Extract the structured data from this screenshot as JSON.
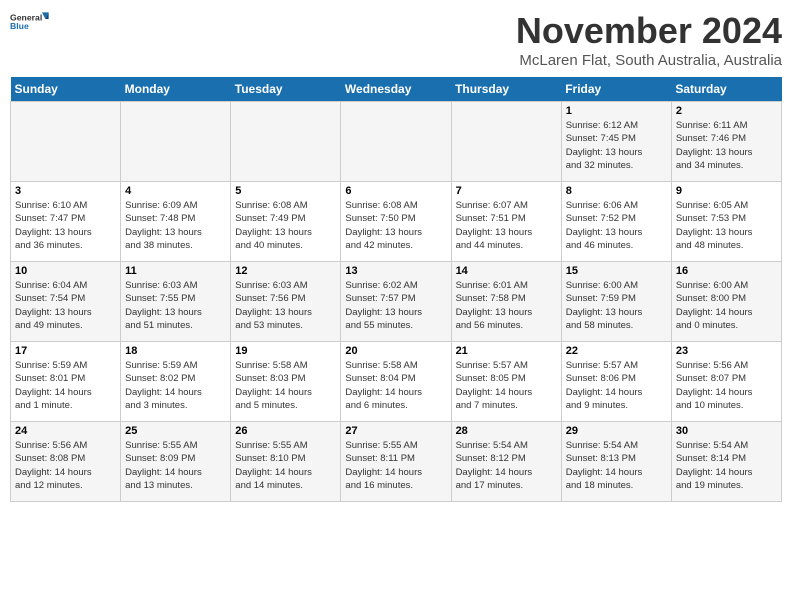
{
  "header": {
    "logo_line1": "General",
    "logo_line2": "Blue",
    "month": "November 2024",
    "location": "McLaren Flat, South Australia, Australia"
  },
  "weekdays": [
    "Sunday",
    "Monday",
    "Tuesday",
    "Wednesday",
    "Thursday",
    "Friday",
    "Saturday"
  ],
  "weeks": [
    [
      {
        "day": "",
        "info": ""
      },
      {
        "day": "",
        "info": ""
      },
      {
        "day": "",
        "info": ""
      },
      {
        "day": "",
        "info": ""
      },
      {
        "day": "",
        "info": ""
      },
      {
        "day": "1",
        "info": "Sunrise: 6:12 AM\nSunset: 7:45 PM\nDaylight: 13 hours\nand 32 minutes."
      },
      {
        "day": "2",
        "info": "Sunrise: 6:11 AM\nSunset: 7:46 PM\nDaylight: 13 hours\nand 34 minutes."
      }
    ],
    [
      {
        "day": "3",
        "info": "Sunrise: 6:10 AM\nSunset: 7:47 PM\nDaylight: 13 hours\nand 36 minutes."
      },
      {
        "day": "4",
        "info": "Sunrise: 6:09 AM\nSunset: 7:48 PM\nDaylight: 13 hours\nand 38 minutes."
      },
      {
        "day": "5",
        "info": "Sunrise: 6:08 AM\nSunset: 7:49 PM\nDaylight: 13 hours\nand 40 minutes."
      },
      {
        "day": "6",
        "info": "Sunrise: 6:08 AM\nSunset: 7:50 PM\nDaylight: 13 hours\nand 42 minutes."
      },
      {
        "day": "7",
        "info": "Sunrise: 6:07 AM\nSunset: 7:51 PM\nDaylight: 13 hours\nand 44 minutes."
      },
      {
        "day": "8",
        "info": "Sunrise: 6:06 AM\nSunset: 7:52 PM\nDaylight: 13 hours\nand 46 minutes."
      },
      {
        "day": "9",
        "info": "Sunrise: 6:05 AM\nSunset: 7:53 PM\nDaylight: 13 hours\nand 48 minutes."
      }
    ],
    [
      {
        "day": "10",
        "info": "Sunrise: 6:04 AM\nSunset: 7:54 PM\nDaylight: 13 hours\nand 49 minutes."
      },
      {
        "day": "11",
        "info": "Sunrise: 6:03 AM\nSunset: 7:55 PM\nDaylight: 13 hours\nand 51 minutes."
      },
      {
        "day": "12",
        "info": "Sunrise: 6:03 AM\nSunset: 7:56 PM\nDaylight: 13 hours\nand 53 minutes."
      },
      {
        "day": "13",
        "info": "Sunrise: 6:02 AM\nSunset: 7:57 PM\nDaylight: 13 hours\nand 55 minutes."
      },
      {
        "day": "14",
        "info": "Sunrise: 6:01 AM\nSunset: 7:58 PM\nDaylight: 13 hours\nand 56 minutes."
      },
      {
        "day": "15",
        "info": "Sunrise: 6:00 AM\nSunset: 7:59 PM\nDaylight: 13 hours\nand 58 minutes."
      },
      {
        "day": "16",
        "info": "Sunrise: 6:00 AM\nSunset: 8:00 PM\nDaylight: 14 hours\nand 0 minutes."
      }
    ],
    [
      {
        "day": "17",
        "info": "Sunrise: 5:59 AM\nSunset: 8:01 PM\nDaylight: 14 hours\nand 1 minute."
      },
      {
        "day": "18",
        "info": "Sunrise: 5:59 AM\nSunset: 8:02 PM\nDaylight: 14 hours\nand 3 minutes."
      },
      {
        "day": "19",
        "info": "Sunrise: 5:58 AM\nSunset: 8:03 PM\nDaylight: 14 hours\nand 5 minutes."
      },
      {
        "day": "20",
        "info": "Sunrise: 5:58 AM\nSunset: 8:04 PM\nDaylight: 14 hours\nand 6 minutes."
      },
      {
        "day": "21",
        "info": "Sunrise: 5:57 AM\nSunset: 8:05 PM\nDaylight: 14 hours\nand 7 minutes."
      },
      {
        "day": "22",
        "info": "Sunrise: 5:57 AM\nSunset: 8:06 PM\nDaylight: 14 hours\nand 9 minutes."
      },
      {
        "day": "23",
        "info": "Sunrise: 5:56 AM\nSunset: 8:07 PM\nDaylight: 14 hours\nand 10 minutes."
      }
    ],
    [
      {
        "day": "24",
        "info": "Sunrise: 5:56 AM\nSunset: 8:08 PM\nDaylight: 14 hours\nand 12 minutes."
      },
      {
        "day": "25",
        "info": "Sunrise: 5:55 AM\nSunset: 8:09 PM\nDaylight: 14 hours\nand 13 minutes."
      },
      {
        "day": "26",
        "info": "Sunrise: 5:55 AM\nSunset: 8:10 PM\nDaylight: 14 hours\nand 14 minutes."
      },
      {
        "day": "27",
        "info": "Sunrise: 5:55 AM\nSunset: 8:11 PM\nDaylight: 14 hours\nand 16 minutes."
      },
      {
        "day": "28",
        "info": "Sunrise: 5:54 AM\nSunset: 8:12 PM\nDaylight: 14 hours\nand 17 minutes."
      },
      {
        "day": "29",
        "info": "Sunrise: 5:54 AM\nSunset: 8:13 PM\nDaylight: 14 hours\nand 18 minutes."
      },
      {
        "day": "30",
        "info": "Sunrise: 5:54 AM\nSunset: 8:14 PM\nDaylight: 14 hours\nand 19 minutes."
      }
    ]
  ]
}
